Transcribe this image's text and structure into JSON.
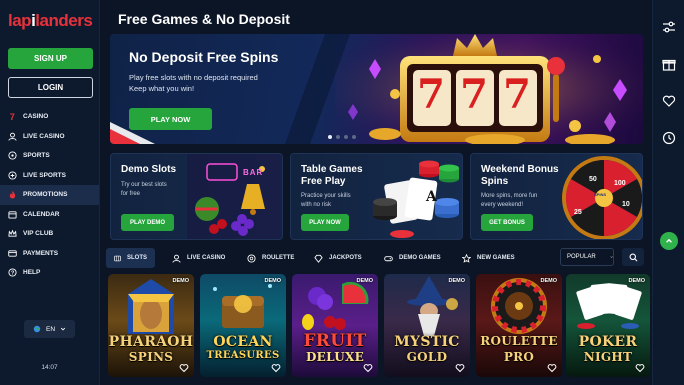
{
  "brand": {
    "logo_part1": "lap",
    "logo_part2": "i",
    "logo_part3": "landers",
    "accent": "#e8313a",
    "green": "#27a53d"
  },
  "auth": {
    "signup": "SIGN UP",
    "login": "LOGIN"
  },
  "sidebar": {
    "items": [
      {
        "label": "CASINO",
        "icon": "seven-icon"
      },
      {
        "label": "LIVE CASINO",
        "icon": "dealer-icon"
      },
      {
        "label": "SPORTS",
        "icon": "ball-icon"
      },
      {
        "label": "LIVE SPORTS",
        "icon": "live-icon"
      },
      {
        "label": "PROMOTIONS",
        "icon": "flame-icon"
      },
      {
        "label": "CALENDAR",
        "icon": "calendar-icon"
      },
      {
        "label": "VIP CLUB",
        "icon": "crown-icon"
      },
      {
        "label": "PAYMENTS",
        "icon": "card-icon"
      },
      {
        "label": "HELP",
        "icon": "help-icon"
      }
    ],
    "language": "EN",
    "time": "14:07"
  },
  "page": {
    "title": "Free Games & No Deposit"
  },
  "hero": {
    "title": "No Deposit Free Spins",
    "sub_line1": "Play free slots with no deposit required",
    "sub_line2": "Keep what you win!",
    "cta": "PLAY NOW",
    "slot_symbols": [
      "7",
      "7",
      "7"
    ]
  },
  "promos": [
    {
      "title": "Demo Slots",
      "sub_line1": "Try our best slots",
      "sub_line2": "for free",
      "cta": "PLAY DEMO",
      "neon": "BAR"
    },
    {
      "title_line1": "Table Games",
      "title_line2": "Free Play",
      "sub_line1": "Practice your skills",
      "sub_line2": "with no risk",
      "cta": "PLAY NOW",
      "card_rank": "A"
    },
    {
      "title_line1": "Weekend Bonus",
      "title_line2": "Spins",
      "sub_line1": "More spins, more fun",
      "sub_line2": "every weekend!",
      "cta": "GET BONUS",
      "wheel_values": [
        "50",
        "100",
        "10",
        "25",
        "50",
        "20"
      ],
      "wheel_label": "SPINS"
    }
  ],
  "tabs": [
    "SLOTS",
    "LIVE CASINO",
    "ROULETTE",
    "JACKPOTS",
    "DEMO GAMES",
    "NEW GAMES"
  ],
  "sort": {
    "label": "POPULAR"
  },
  "games": [
    {
      "line1": "PHARAOH",
      "line2": "SPINS",
      "badge": "DEMO"
    },
    {
      "line1": "OCEAN",
      "line2": "TREASURES",
      "badge": "DEMO"
    },
    {
      "line1": "FRUIT",
      "line2": "DELUXE",
      "badge": "DEMO"
    },
    {
      "line1": "MYSTIC",
      "line2": "GOLD",
      "badge": "DEMO"
    },
    {
      "line1": "ROULETTE",
      "line2": "PRO",
      "badge": "DEMO"
    },
    {
      "line1": "POKER",
      "line2": "NIGHT",
      "badge": "DEMO"
    }
  ]
}
